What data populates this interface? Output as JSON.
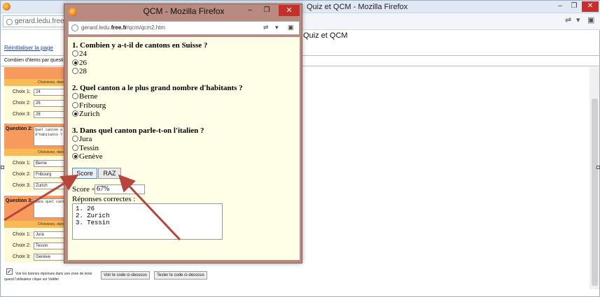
{
  "background_browser": {
    "title": "Quiz et QCM - Mozilla Firefox",
    "url": "gerard.ledu.free.fr/qcm",
    "page_heading": "Quiz et QCM",
    "reset_link": "Réinitialiser la page",
    "items_per_question_label": "Combien d'items par questi",
    "controls": {
      "minimize": "–",
      "restore": "❐",
      "close": "✕"
    },
    "form": {
      "band_text": "Choisissez, dans l'o",
      "choice1_label": "Choix 1:",
      "choice2_label": "Choix 2:",
      "choice3_label": "Choix 3:",
      "q1": {
        "choices": [
          "24",
          "26",
          "28"
        ]
      },
      "q2": {
        "label": "Question 2:",
        "text": "Quel canton a\nd'habitants ?",
        "choices": [
          "Berne",
          "Fribourg",
          "Zurich"
        ]
      },
      "q3": {
        "label": "Question 3:",
        "text": "Dans quel cant",
        "choices": [
          "Jura",
          "Tessin",
          "Genève"
        ]
      }
    },
    "checkbox_label_line1": "Voir les bonnes réponses dans une zone de texte",
    "checkbox_label_line2": "quand l'utilisateur clique sur Valider",
    "view_code_button": "Voir le code ci-dessous",
    "test_code_button": "Tester le code ci-dessous"
  },
  "popup": {
    "title": "QCM - Mozilla Firefox",
    "url_prefix": "gerard.ledu.",
    "url_domain": "free.fr",
    "url_path": "/qcm/qcm2.htm",
    "controls": {
      "minimize": "–",
      "restore": "❐",
      "close": "✕"
    },
    "questions": [
      {
        "title": "1. Combien y a-t-il de cantons en Suisse ?",
        "options": [
          "24",
          "26",
          "28"
        ],
        "selected": 1
      },
      {
        "title": "2. Quel canton a le plus grand nombre d'habitants ?",
        "options": [
          "Berne",
          "Fribourg",
          "Zurich"
        ],
        "selected": 2
      },
      {
        "title": "3. Dans quel canton parle-t-on l'italien ?",
        "options": [
          "Jura",
          "Tessin",
          "Genève"
        ],
        "selected": 2
      }
    ],
    "score_button": "Score",
    "raz_button": "RAZ",
    "score_label": "Score =",
    "score_value": "67%",
    "answers_label": "Réponses correctes :",
    "answers_text": "1. 26\n2. Zurich\n3. Tessin"
  },
  "colors": {
    "question_header": "#f79a5e",
    "question_band": "#f9ba55",
    "question_body": "#fffbd6",
    "popup_frame": "#b98a7f",
    "popup_content": "#fffee6",
    "arrow": "#b8443c"
  }
}
